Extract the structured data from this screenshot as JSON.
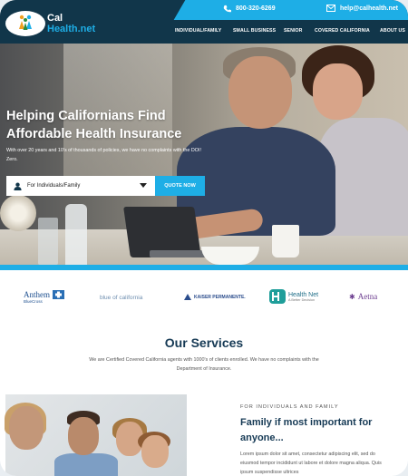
{
  "header": {
    "logo": {
      "line1": "Cal",
      "line2": "Health.net"
    },
    "phone": "800-320-6269",
    "email": "help@calhealth.net",
    "nav": [
      "INDIVIDUAL/FAMILY",
      "SMALL BUSINESS",
      "SENIOR",
      "COVERED CALIFORNIA",
      "ABOUT US"
    ]
  },
  "hero": {
    "title_line1": "Helping Californians Find",
    "title_line2": "Affordable Health Insurance",
    "subtitle": "With over 20 years and 10's of thousands of policies, we have no complaints with the DOI! Zero.",
    "select_value": "For Individuals/Family",
    "quote_button": "QUOTE NOW"
  },
  "logos": {
    "anthem_line1": "Anthem",
    "anthem_line2": "BlueCross",
    "blueshield": "blue of california",
    "kaiser": "KAISER PERMANENTE.",
    "healthnet": "Health Net",
    "healthnet_tag": "A Better Decision",
    "aetna": "Aetna"
  },
  "services": {
    "title": "Our Services",
    "subtitle": "We are Certified Covered California agents with 1000's of clients enrolled. We have no complaints with the Department of Insurance."
  },
  "family": {
    "eyebrow": "FOR INDIVIDUALS AND FAMILY",
    "title": "Family if most important for anyone...",
    "body": "Lorem ipsum dolor sit amet, consectetur adipiscing elit, sed do eiusmod tempor incididunt ut labore et dolore magna aliqua. Quis ipsum suspendisse ultrices"
  },
  "colors": {
    "navy": "#11364a",
    "accent": "#1eaee6",
    "heading": "#163a55"
  }
}
